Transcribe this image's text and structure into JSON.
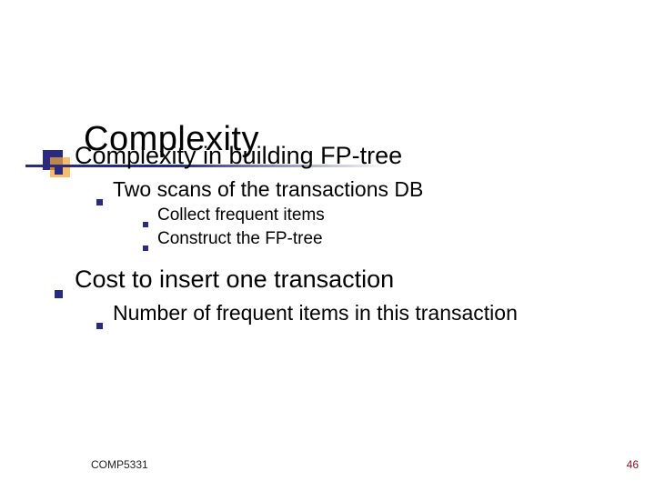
{
  "slide": {
    "title": "Complexity",
    "bullets": [
      {
        "text": "Complexity in building FP-tree",
        "children": [
          {
            "text": "Two scans of the transactions DB",
            "children": [
              {
                "text": "Collect frequent items"
              },
              {
                "text": "Construct the FP-tree"
              }
            ]
          }
        ]
      },
      {
        "text": "Cost to insert one transaction",
        "children": [
          {
            "text": "Number of frequent items in this transaction"
          }
        ]
      }
    ],
    "footer": {
      "course": "COMP5331",
      "page": "46"
    },
    "accent": {
      "navy": "#2a2a80",
      "orange": "#f2a73c"
    }
  }
}
